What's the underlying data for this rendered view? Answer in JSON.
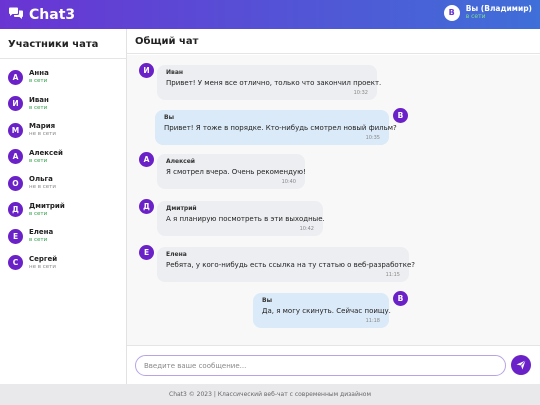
{
  "app": {
    "name": "Chat3",
    "icon": "chat-bubbles-icon",
    "accent": "#6b21c8"
  },
  "user": {
    "initial": "В",
    "name": "Вы (Владимир)",
    "status": "в сети"
  },
  "sidebar": {
    "title": "Участники чата",
    "participants": [
      {
        "initial": "А",
        "name": "Анна",
        "status": "в сети"
      },
      {
        "initial": "И",
        "name": "Иван",
        "status": "в сети"
      },
      {
        "initial": "М",
        "name": "Мария",
        "status": "не в сети"
      },
      {
        "initial": "А",
        "name": "Алексей",
        "status": "в сети"
      },
      {
        "initial": "О",
        "name": "Ольга",
        "status": "не в сети"
      },
      {
        "initial": "Д",
        "name": "Дмитрий",
        "status": "в сети"
      },
      {
        "initial": "Е",
        "name": "Елена",
        "status": "в сети"
      },
      {
        "initial": "С",
        "name": "Сергей",
        "status": "не в сети"
      }
    ]
  },
  "chat": {
    "title": "Общий чат",
    "messages": [
      {
        "initial": "И",
        "author": "Иван",
        "text": "Привет! У меня все отлично, только что закончил проект.",
        "time": "10:32",
        "outgoing": false
      },
      {
        "initial": "В",
        "author": "Вы",
        "text": "Привет! Я тоже в порядке. Кто-нибудь смотрел новый фильм?",
        "time": "10:35",
        "outgoing": true
      },
      {
        "initial": "А",
        "author": "Алексей",
        "text": "Я смотрел вчера. Очень рекомендую!",
        "time": "10:40",
        "outgoing": false
      },
      {
        "initial": "Д",
        "author": "Дмитрий",
        "text": "А я планирую посмотреть в эти выходные.",
        "time": "10:42",
        "outgoing": false
      },
      {
        "initial": "Е",
        "author": "Елена",
        "text": "Ребята, у кого-нибудь есть ссылка на ту статью о веб-разработке?",
        "time": "11:15",
        "outgoing": false
      },
      {
        "initial": "В",
        "author": "Вы",
        "text": "Да, я могу скинуть. Сейчас поищу.",
        "time": "11:18",
        "outgoing": true
      }
    ]
  },
  "composer": {
    "placeholder": "Введите ваше сообщение...",
    "send_icon": "send-icon"
  },
  "footer": {
    "text": "Chat3 © 2023 | Классический веб-чат с современным дизайном"
  }
}
